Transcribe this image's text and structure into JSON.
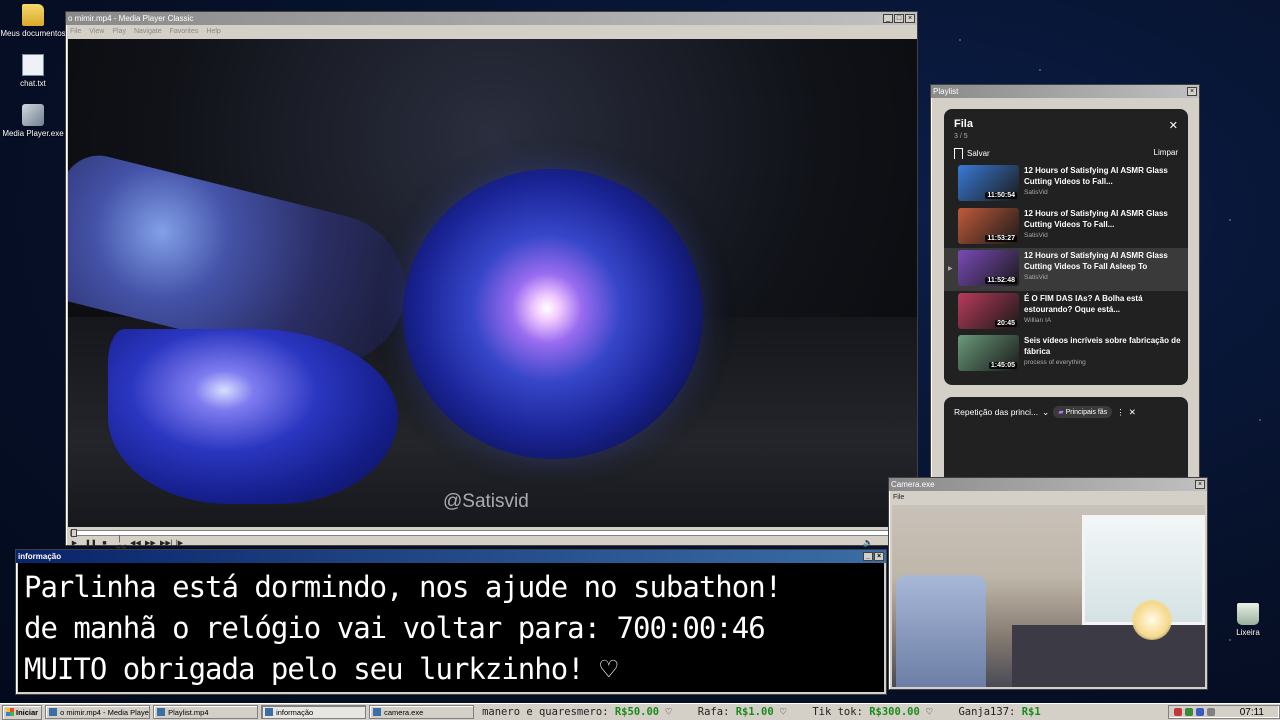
{
  "desktop": {
    "icons": [
      {
        "label": "Meus documentos",
        "icon": "folder-icon"
      },
      {
        "label": "chat.txt",
        "icon": "text-file-icon"
      },
      {
        "label": "Media Player.exe",
        "icon": "media-player-icon"
      },
      {
        "label": "Lixeira",
        "icon": "recycle-bin-icon"
      }
    ]
  },
  "media_player": {
    "title": "o mimir.mp4 - Media Player Classic",
    "menu": [
      "File",
      "View",
      "Play",
      "Navigate",
      "Favorites",
      "Help"
    ],
    "watermark": "@Satisvid",
    "seek_position": 0.0
  },
  "playlist_window": {
    "title": "Playlist",
    "queue_title": "Fila",
    "queue_count": "3 / 5",
    "save_label": "Salvar",
    "clear_label": "Limpar",
    "items": [
      {
        "title": "12 Hours of Satisfying AI ASMR Glass Cutting Videos to Fall...",
        "channel": "SatisVid",
        "duration": "11:50:54",
        "current": false,
        "thumb_color": "#3a7ad8"
      },
      {
        "title": "12 Hours of Satisfying AI ASMR Glass Cutting Videos To Fall...",
        "channel": "SatisVid",
        "duration": "11:53:27",
        "current": false,
        "thumb_color": "#c05a3a"
      },
      {
        "title": "12 Hours of Satisfying AI ASMR Glass Cutting Videos To Fall Asleep To",
        "channel": "SatisVid",
        "duration": "11:52:48",
        "current": true,
        "thumb_color": "#7a4ab8"
      },
      {
        "title": "É O FIM DAS IAs? A Bolha está estourando? Oque está...",
        "channel": "Willian IA",
        "duration": "20:45",
        "current": false,
        "thumb_color": "#b83a5a"
      },
      {
        "title": "Seis vídeos incríveis sobre fabricação de fábrica",
        "channel": "process of everything",
        "duration": "1:45:05",
        "current": false,
        "thumb_color": "#6a9a7a"
      }
    ],
    "loop_label": "Repetição das princi...",
    "chip_label": "Principais fãs"
  },
  "info_window": {
    "title": "informação",
    "lines": [
      "Parlinha está dormindo, nos ajude no subathon!",
      "de manhã o relógio vai voltar para:  700:00:46",
      "MUITO obrigada pelo seu lurkzinho! ♡"
    ]
  },
  "camera_window": {
    "title": "Camera.exe",
    "menu_file": "File"
  },
  "taskbar": {
    "start_label": "Iniciar",
    "tasks": [
      {
        "label": "o mimir.mp4 - Media Playe...",
        "pressed": false
      },
      {
        "label": "Playlist.mp4",
        "pressed": false
      },
      {
        "label": "informação",
        "pressed": true
      },
      {
        "label": "camera.exe",
        "pressed": false
      }
    ],
    "ticker": [
      {
        "name": "manero e quaresmero:",
        "amount": "R$50.00",
        "sep": "♡"
      },
      {
        "name": "Rafa:",
        "amount": "R$1.00",
        "sep": "♡"
      },
      {
        "name": "Tik tok:",
        "amount": "R$300.00",
        "sep": "♡"
      },
      {
        "name": "Ganja137:",
        "amount": "R$1",
        "sep": ""
      }
    ],
    "clock": "07:11"
  },
  "colors": {
    "accent_title": "#0a246a",
    "ticker_amount": "#1a8a1a",
    "youtube_panel": "#212121"
  }
}
